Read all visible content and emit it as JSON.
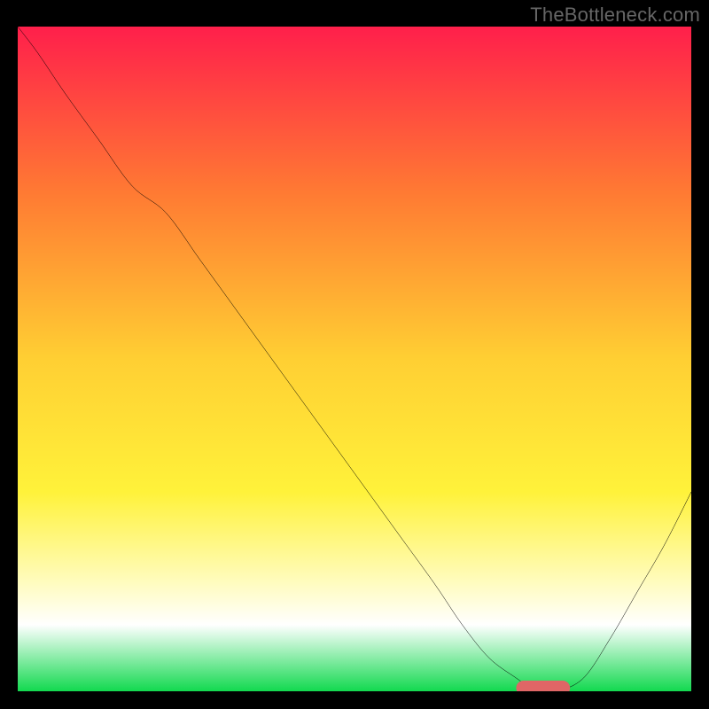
{
  "watermark": "TheBottleneck.com",
  "chart_data": {
    "type": "line",
    "title": "",
    "xlabel": "",
    "ylabel": "",
    "xlim": [
      0,
      100
    ],
    "ylim": [
      0,
      100
    ],
    "grid": false,
    "background": {
      "gradient_stops": [
        {
          "offset": 0.0,
          "color": "#ff1f4b"
        },
        {
          "offset": 0.25,
          "color": "#ff7a33"
        },
        {
          "offset": 0.5,
          "color": "#ffcf33"
        },
        {
          "offset": 0.7,
          "color": "#fff23a"
        },
        {
          "offset": 0.84,
          "color": "#fffcc2"
        },
        {
          "offset": 0.9,
          "color": "#ffffff"
        },
        {
          "offset": 1.0,
          "color": "#12d94f"
        }
      ]
    },
    "series": [
      {
        "name": "bottleneck-curve",
        "stroke": "#000000",
        "x": [
          0,
          3,
          7,
          12,
          17,
          22,
          27,
          32,
          37,
          42,
          47,
          52,
          57,
          62,
          66,
          70,
          74,
          77,
          80,
          84,
          88,
          92,
          96,
          100
        ],
        "y": [
          100,
          96,
          90,
          83,
          76,
          72,
          65,
          58,
          51,
          44,
          37,
          30,
          23,
          16,
          10,
          5,
          2,
          0,
          0,
          2,
          8,
          15,
          22,
          30
        ]
      }
    ],
    "marker": {
      "name": "target-bar",
      "color": "#e06666",
      "x_start": 74,
      "x_end": 82,
      "y_center": 0.5,
      "height": 2.2,
      "rx": 1.1
    }
  }
}
